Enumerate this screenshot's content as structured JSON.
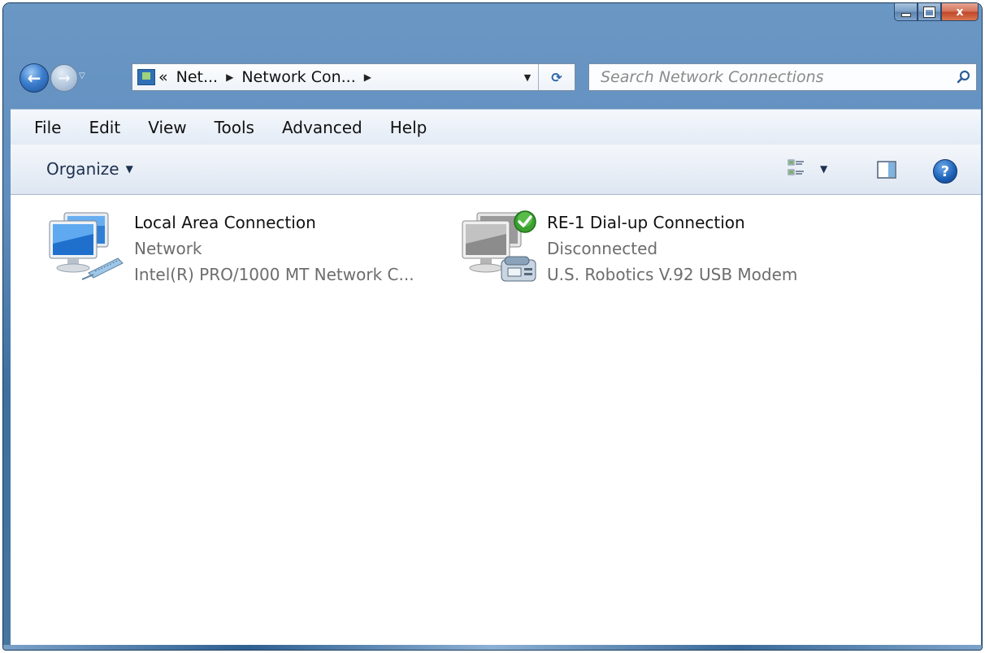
{
  "window": {
    "caption_buttons": {
      "minimize": "minimize",
      "maximize": "maximize",
      "close": "x"
    }
  },
  "nav": {
    "back_glyph": "←",
    "forward_glyph": "→",
    "history_glyph": "▽",
    "breadcrumb": {
      "overflow": "«",
      "items": [
        "Net...",
        "Network Con..."
      ],
      "separator": "▶"
    },
    "address_dropdown_glyph": "▼",
    "refresh_glyph": "⟳",
    "search_placeholder": "Search Network Connections"
  },
  "menu": {
    "items": [
      "File",
      "Edit",
      "View",
      "Tools",
      "Advanced",
      "Help"
    ]
  },
  "command_bar": {
    "organize_label": "Organize",
    "dropdown_glyph": "▼",
    "help_glyph": "?"
  },
  "connections": [
    {
      "name": "Local Area Connection",
      "status": "Network",
      "device": "Intel(R) PRO/1000 MT Network C...",
      "icon": "network-cable-icon"
    },
    {
      "name": "RE-1 Dial-up Connection",
      "status": "Disconnected",
      "device": "U.S. Robotics V.92 USB Modem",
      "icon": "dialup-modem-icon",
      "badge": "default-connection-check-icon"
    }
  ],
  "colors": {
    "frame_blue": "#5f8ebf",
    "close_red": "#c2452a",
    "subtitle_gray": "#6d6d6d",
    "check_green": "#3aa12f"
  }
}
